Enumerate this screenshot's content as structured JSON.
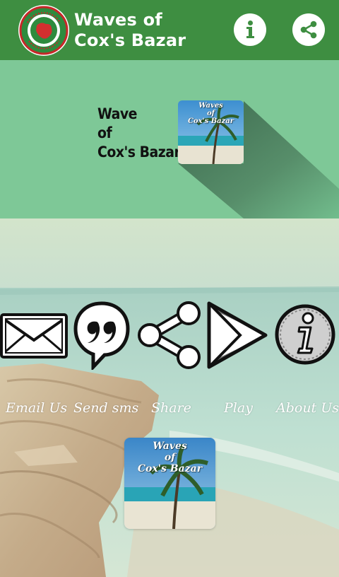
{
  "app_bar": {
    "title_line1": "Waves of",
    "title_line2": "Cox's Bazar",
    "logo_icon": "government-seal-logo",
    "info_button_icon": "info-icon",
    "share_button_icon": "share-icon",
    "bar_color": "#3e8e41"
  },
  "header": {
    "title_line1": "Wave",
    "title_line2": "of",
    "title_line3": "Cox's Bazar",
    "thumb_line1": "Waves",
    "thumb_line2": "of",
    "thumb_line3": "Cox's Bazar",
    "panel_color": "#7ec897"
  },
  "actions": [
    {
      "label": "Email Us",
      "icon": "envelope-icon"
    },
    {
      "label": "Send sms",
      "icon": "speech-bubble-quote-icon"
    },
    {
      "label": "Share",
      "icon": "share-icon"
    },
    {
      "label": "Play",
      "icon": "play-store-icon"
    },
    {
      "label": "About Us",
      "icon": "info-icon"
    }
  ],
  "center_thumb": {
    "line1": "Waves",
    "line2": "of",
    "line3": "Cox's Bazar"
  }
}
